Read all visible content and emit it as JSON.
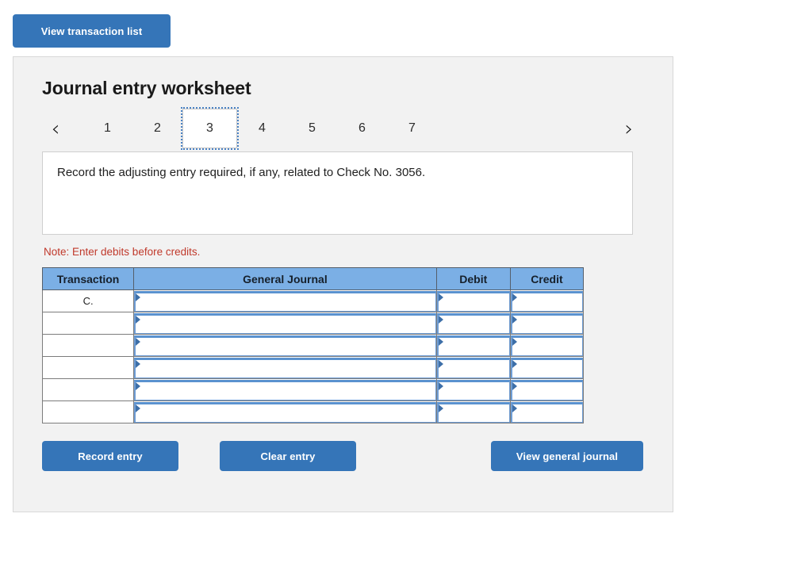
{
  "top": {
    "view_transaction_list": "View transaction list"
  },
  "worksheet": {
    "title": "Journal entry worksheet",
    "prev_arrow": "‹",
    "next_arrow": "›",
    "pages": [
      "1",
      "2",
      "3",
      "4",
      "5",
      "6",
      "7"
    ],
    "selected_page": "3",
    "prompt": "Record the adjusting entry required, if any, related to Check No. 3056.",
    "note": "Note: Enter debits before credits."
  },
  "table": {
    "headers": {
      "transaction": "Transaction",
      "general_journal": "General Journal",
      "debit": "Debit",
      "credit": "Credit"
    },
    "rows": [
      {
        "transaction": "C.",
        "general_journal": "",
        "debit": "",
        "credit": ""
      },
      {
        "transaction": "",
        "general_journal": "",
        "debit": "",
        "credit": ""
      },
      {
        "transaction": "",
        "general_journal": "",
        "debit": "",
        "credit": ""
      },
      {
        "transaction": "",
        "general_journal": "",
        "debit": "",
        "credit": ""
      },
      {
        "transaction": "",
        "general_journal": "",
        "debit": "",
        "credit": ""
      },
      {
        "transaction": "",
        "general_journal": "",
        "debit": "",
        "credit": ""
      }
    ]
  },
  "actions": {
    "record_entry": "Record entry",
    "clear_entry": "Clear entry",
    "view_general_journal": "View general journal"
  },
  "colors": {
    "button_blue": "#3575b8",
    "header_blue": "#7bafe5",
    "note_red": "#c0392b",
    "panel_gray": "#f2f2f2",
    "input_border_blue": "#6f9ed6"
  }
}
